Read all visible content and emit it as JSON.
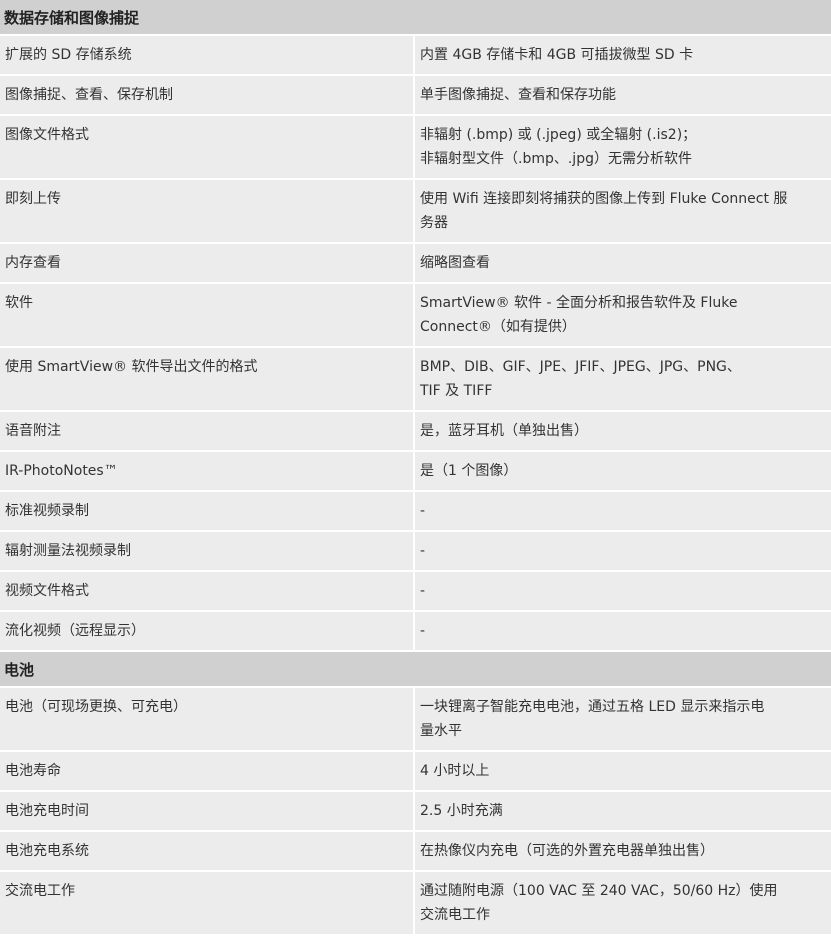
{
  "sections": [
    {
      "title": "数据存储和图像捕捉",
      "rows": [
        {
          "label": "扩展的 SD 存储系统",
          "value": [
            "内置 4GB 存储卡和 4GB 可插拔微型 SD 卡"
          ]
        },
        {
          "label": "图像捕捉、查看、保存机制",
          "value": [
            "单手图像捕捉、查看和保存功能"
          ]
        },
        {
          "label": "图像文件格式",
          "value": [
            "非辐射 (.bmp) 或 (.jpeg) 或全辐射 (.is2)；",
            "非辐射型文件（.bmp、.jpg）无需分析软件"
          ]
        },
        {
          "label": "即刻上传",
          "value": [
            "使用 Wifi 连接即刻将捕获的图像上传到 Fluke Connect 服",
            "务器"
          ]
        },
        {
          "label": "内存查看",
          "value": [
            "缩略图查看"
          ]
        },
        {
          "label": "软件",
          "value": [
            "SmartView® 软件 - 全面分析和报告软件及 Fluke",
            "Connect®（如有提供）"
          ]
        },
        {
          "label": "使用 SmartView® 软件导出文件的格式",
          "value": [
            "BMP、DIB、GIF、JPE、JFIF、JPEG、JPG、PNG、",
            "TIF 及 TIFF"
          ]
        },
        {
          "label": "语音附注",
          "value": [
            "是，蓝牙耳机（单独出售）"
          ]
        },
        {
          "label": "IR-PhotoNotes™",
          "value": [
            "是（1 个图像）"
          ]
        },
        {
          "label": "标准视频录制",
          "value": [
            "-"
          ]
        },
        {
          "label": "辐射测量法视频录制",
          "value": [
            "-"
          ]
        },
        {
          "label": "视频文件格式",
          "value": [
            "-"
          ]
        },
        {
          "label": "流化视频（远程显示）",
          "value": [
            "-"
          ]
        }
      ]
    },
    {
      "title": "电池",
      "rows": [
        {
          "label": "电池（可现场更换、可充电）",
          "value": [
            "一块锂离子智能充电电池，通过五格 LED 显示来指示电",
            "量水平"
          ]
        },
        {
          "label": "电池寿命",
          "value": [
            "4 小时以上"
          ]
        },
        {
          "label": "电池充电时间",
          "value": [
            "2.5 小时充满"
          ]
        },
        {
          "label": "电池充电系统",
          "value": [
            "在热像仪内充电（可选的外置充电器单独出售）"
          ]
        },
        {
          "label": "交流电工作",
          "value": [
            "通过随附电源（100 VAC 至 240 VAC，50/60 Hz）使用",
            "交流电工作"
          ]
        }
      ]
    }
  ]
}
